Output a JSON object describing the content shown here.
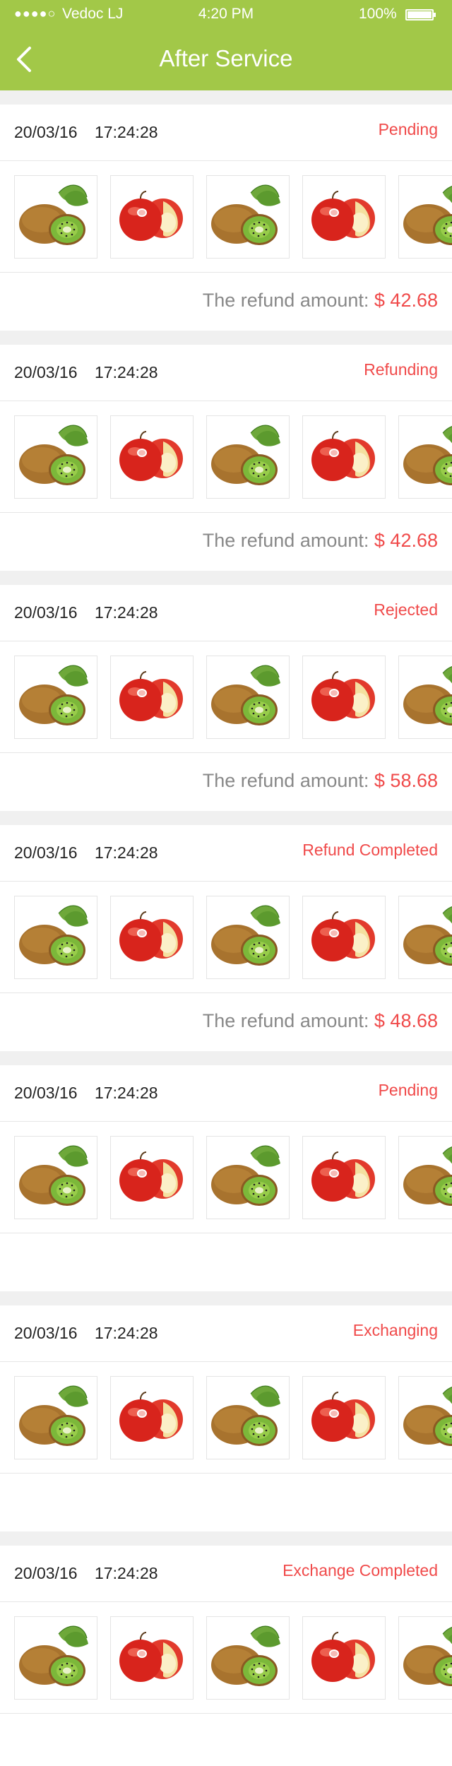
{
  "colors": {
    "accent": "#a2c848",
    "status_red": "#f04a4a"
  },
  "status_bar": {
    "signal": "●●●●○",
    "carrier": "Vedoc LJ",
    "time": "4:20 PM",
    "battery": "100%"
  },
  "header": {
    "back_icon": "chevron-left-icon",
    "title": "After Service"
  },
  "refund_label": "The refund amount:",
  "orders": [
    {
      "date": "20/03/16",
      "time": "17:24:28",
      "status": "Pending",
      "refund_amount": "$ 42.68",
      "items": [
        "kiwi",
        "apple",
        "kiwi",
        "apple",
        "kiwi"
      ]
    },
    {
      "date": "20/03/16",
      "time": "17:24:28",
      "status": "Refunding",
      "refund_amount": "$ 42.68",
      "items": [
        "kiwi",
        "apple",
        "kiwi",
        "apple",
        "kiwi"
      ]
    },
    {
      "date": "20/03/16",
      "time": "17:24:28",
      "status": "Rejected",
      "refund_amount": "$ 58.68",
      "items": [
        "kiwi",
        "apple",
        "kiwi",
        "apple",
        "kiwi"
      ]
    },
    {
      "date": "20/03/16",
      "time": "17:24:28",
      "status": "Refund Completed",
      "refund_amount": "$ 48.68",
      "items": [
        "kiwi",
        "apple",
        "kiwi",
        "apple",
        "kiwi"
      ]
    },
    {
      "date": "20/03/16",
      "time": "17:24:28",
      "status": "Pending",
      "refund_amount": "",
      "items": [
        "kiwi",
        "apple",
        "kiwi",
        "apple",
        "kiwi"
      ]
    },
    {
      "date": "20/03/16",
      "time": "17:24:28",
      "status": "Exchanging",
      "refund_amount": "",
      "items": [
        "kiwi",
        "apple",
        "kiwi",
        "apple",
        "kiwi"
      ]
    },
    {
      "date": "20/03/16",
      "time": "17:24:28",
      "status": "Exchange Completed",
      "refund_amount": "",
      "items": [
        "kiwi",
        "apple",
        "kiwi",
        "apple",
        "kiwi"
      ]
    }
  ]
}
